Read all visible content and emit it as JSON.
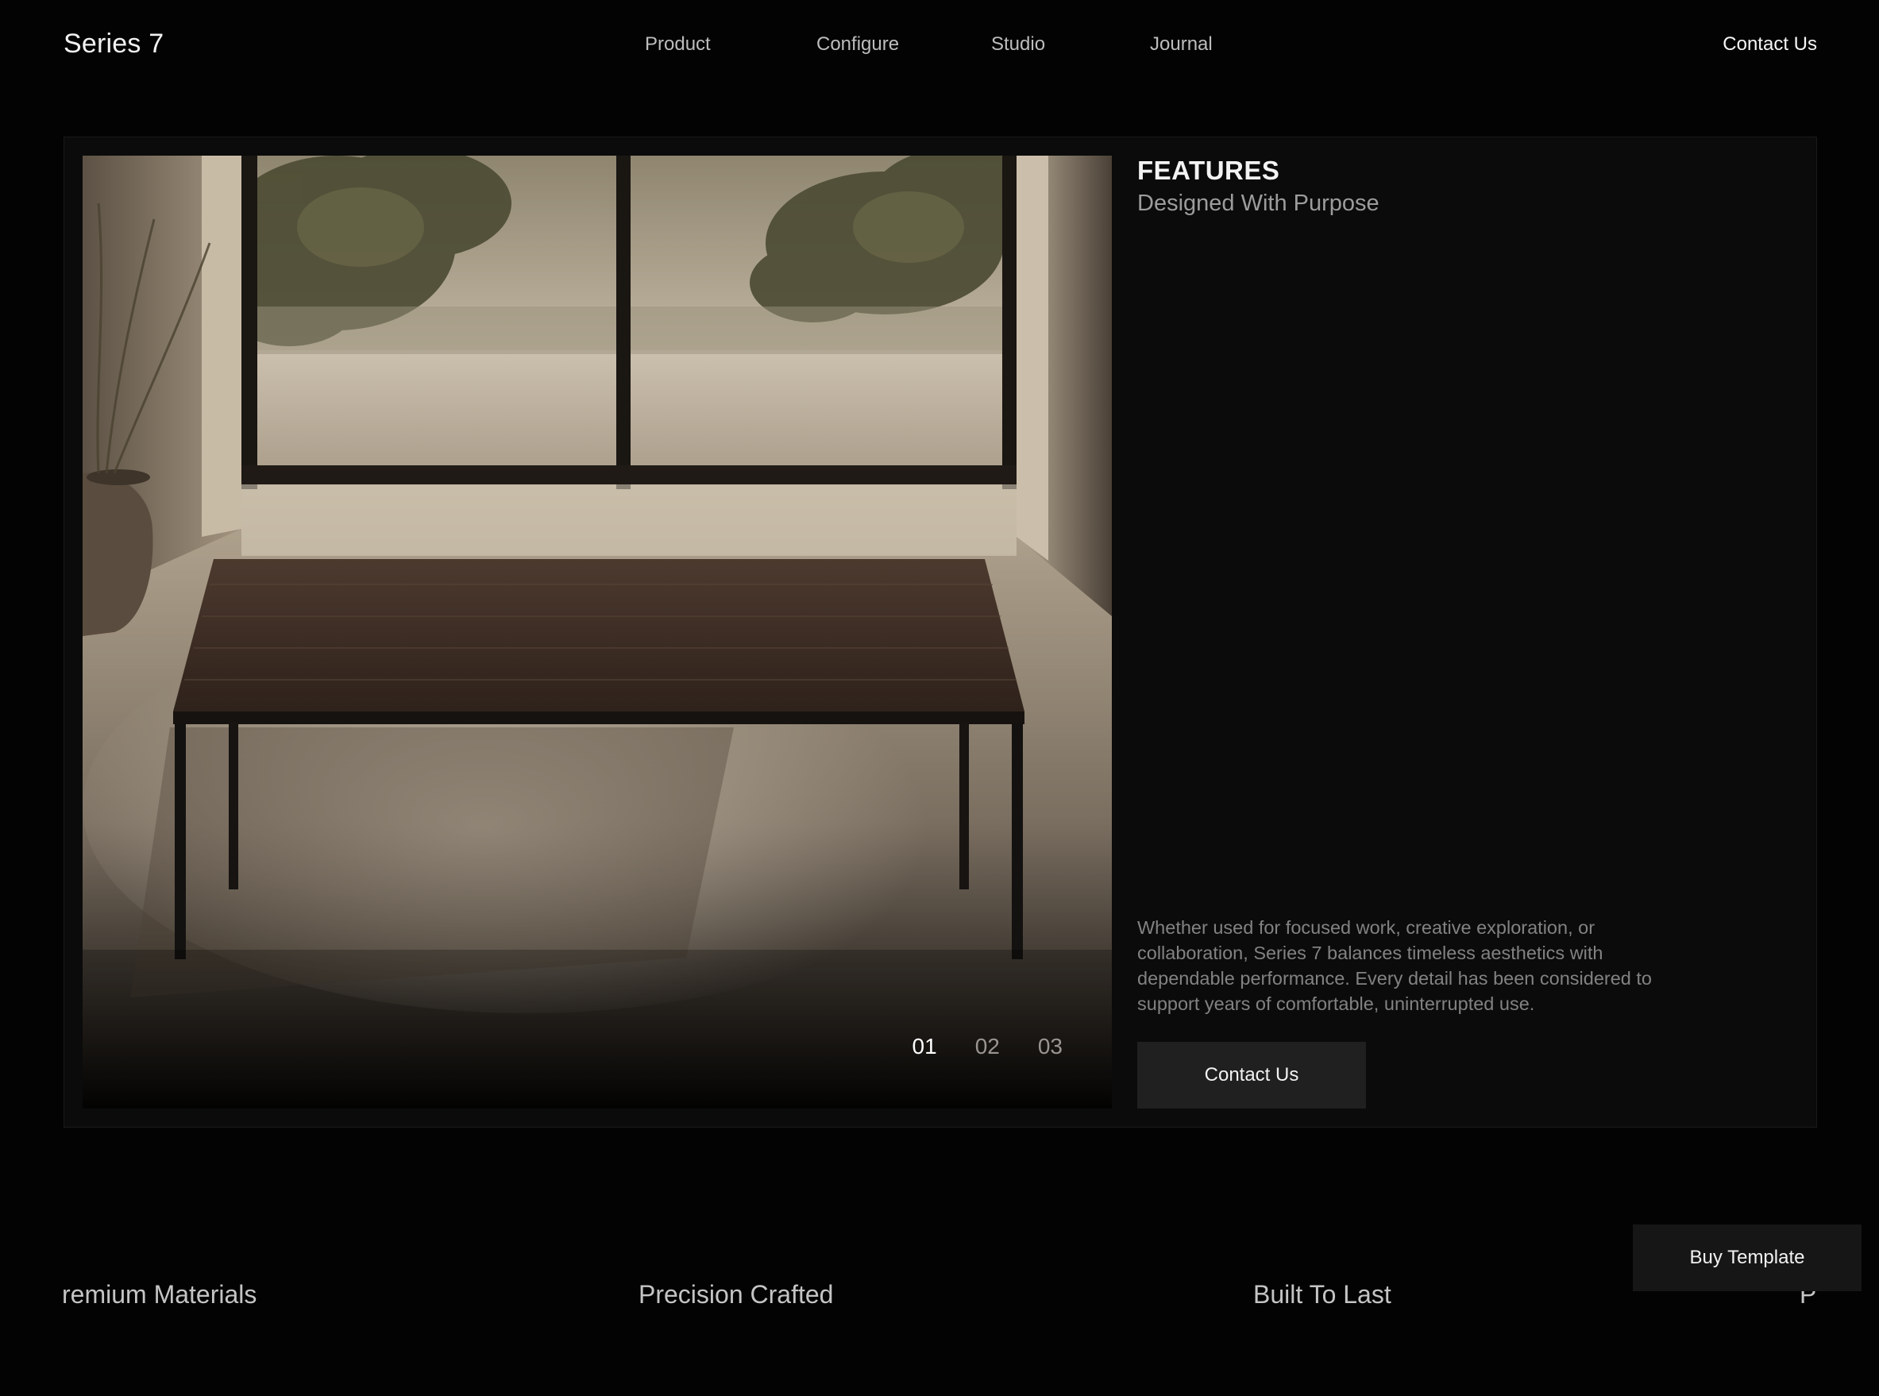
{
  "nav": {
    "brand": "Series 7",
    "links": [
      {
        "label": "Product"
      },
      {
        "label": "Configure"
      },
      {
        "label": "Studio"
      },
      {
        "label": "Journal"
      }
    ],
    "contact_label": "Contact Us"
  },
  "feature": {
    "title": "FEATURES",
    "subtitle": "Designed With Purpose",
    "body": "Whether used for focused work, creative exploration, or collaboration, Series 7 balances timeless aesthetics with dependable performance. Every detail has been considered to support years of comfortable, uninterrupted use.",
    "button_label": "Contact Us",
    "slides": [
      "01",
      "02",
      "03"
    ],
    "active_slide": "01"
  },
  "marquee": {
    "items": [
      "remium Materials",
      "Precision Crafted",
      "Built To Last",
      "P"
    ]
  },
  "floating": {
    "buy_label": "Buy Template"
  }
}
